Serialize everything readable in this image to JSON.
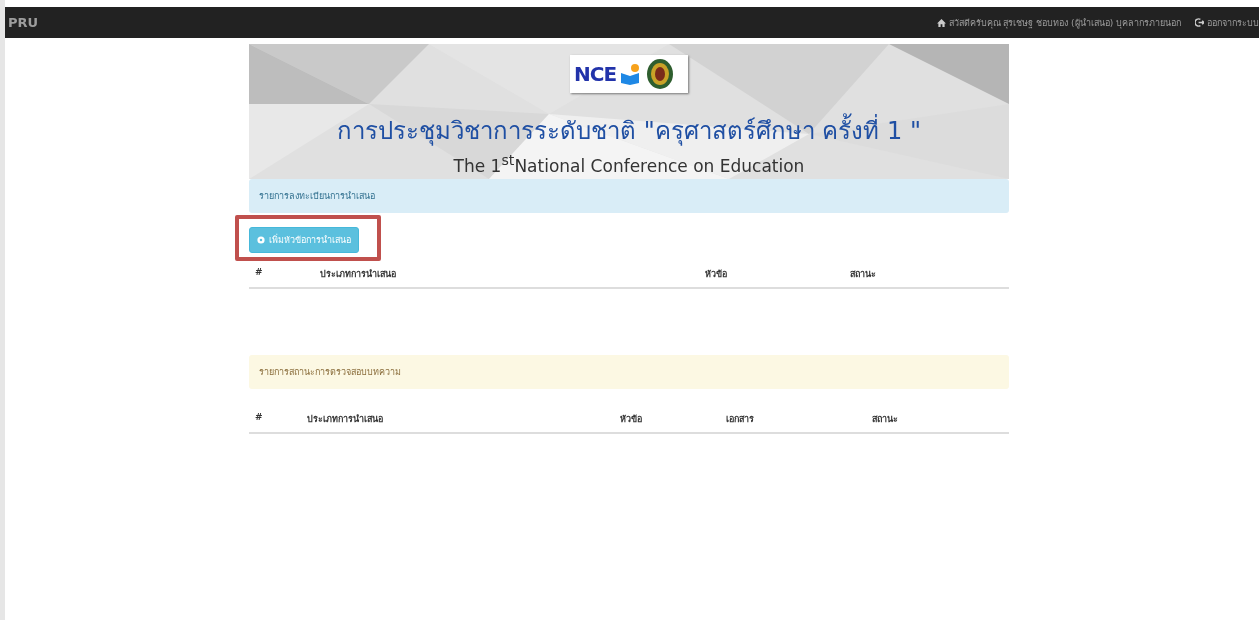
{
  "navbar": {
    "brand": "PRU",
    "user_text": "สวัสดีครับคุณ สุรเชษฐ ชอบทอง (ผู้นำเสนอ) บุคลากรภายนอก",
    "logout": "ออกจากระบบ"
  },
  "banner": {
    "logo_text": "NCE",
    "title_th": "การประชุมวิชาการระดับชาติ \"ครุศาสตร์ศึกษา ครั้งที่ 1 \"",
    "title_en": "The 1$^{st}$National Conference on Education"
  },
  "registration": {
    "heading": "รายการลงทะเบียนการนำเสนอ",
    "add_button": {
      "label": "เพิ่มหัวข้อการนำเสนอ",
      "highlighted": true
    },
    "columns": [
      "#",
      "ประเภทการนำเสนอ",
      "หัวข้อ",
      "สถานะ"
    ]
  },
  "review": {
    "heading": "รายการสถานะการตรวจสอบบทความ",
    "columns": [
      "#",
      "ประเภทการนำเสนอ",
      "หัวข้อ",
      "เอกสาร",
      "สถานะ"
    ]
  }
}
